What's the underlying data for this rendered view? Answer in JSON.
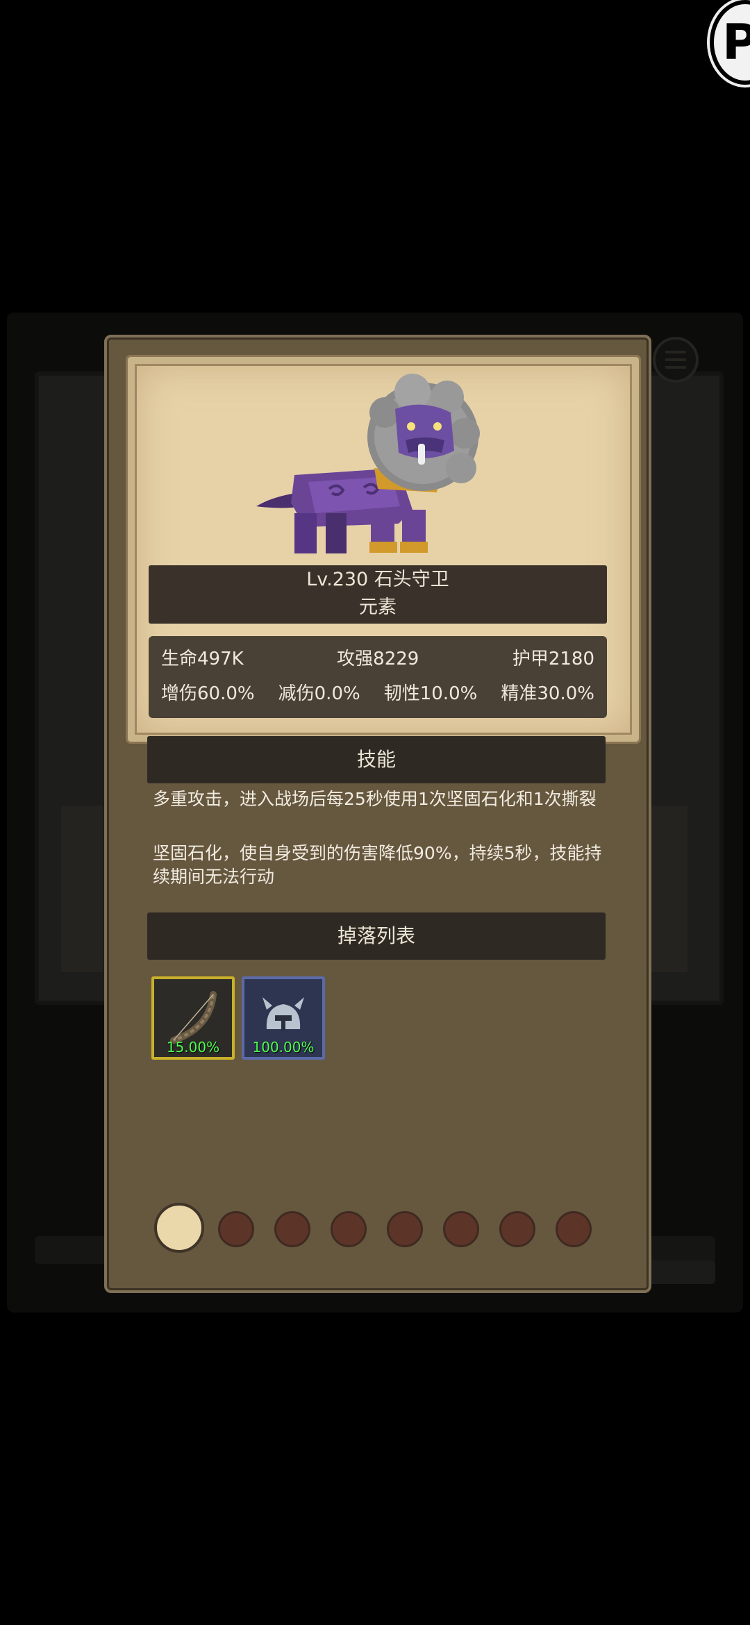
{
  "header": {
    "logo_letter": "P"
  },
  "monster": {
    "name_line": "Lv.230 石头守卫",
    "type": "元素",
    "stats": {
      "hp": "生命497K",
      "attack": "攻强8229",
      "armor": "护甲2180",
      "dmg_increase": "增伤60.0%",
      "dmg_reduction": "减伤0.0%",
      "tenacity": "韧性10.0%",
      "accuracy": "精准30.0%"
    }
  },
  "skills": {
    "header": "技能",
    "desc1": "多重攻击，进入战场后每25秒使用1次坚固石化和1次撕裂",
    "desc2": "坚固石化，使自身受到的伤害降低90%，持续5秒，技能持续期间无法行动"
  },
  "drops": {
    "header": "掉落列表",
    "items": [
      {
        "icon": "bow-icon",
        "rate": "15.00%",
        "border_color": "#c8b02a"
      },
      {
        "icon": "helmet-icon",
        "rate": "100.00%",
        "border_color": "#5c6aa8"
      }
    ]
  },
  "pagination": {
    "total": 8,
    "active_index": 0
  }
}
